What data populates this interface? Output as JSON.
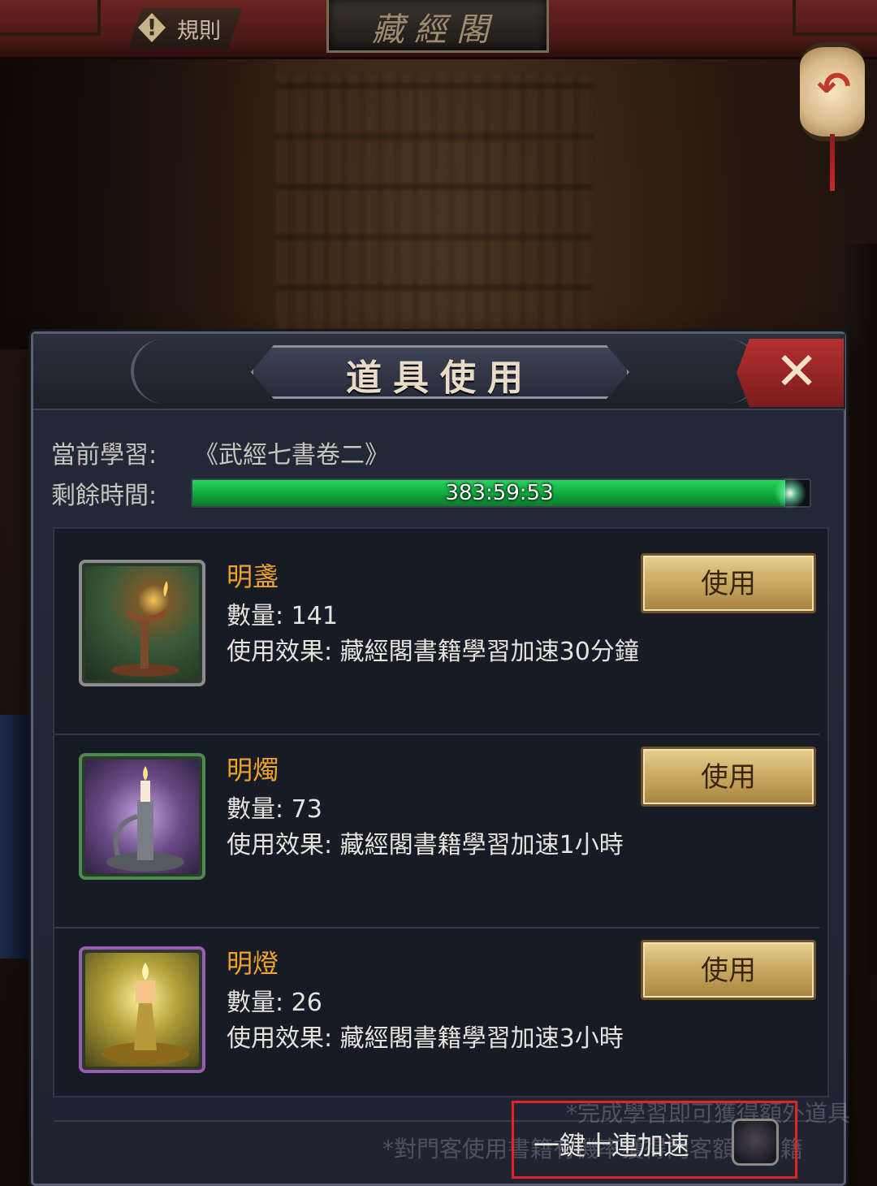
{
  "topbar": {
    "rules_label": "規則",
    "title": "藏經閣"
  },
  "dialog": {
    "title": "道具使用",
    "current_study_label": "當前學習:",
    "current_book": "《武經七書卷二》",
    "remaining_label": "剩餘時間:",
    "remaining_time": "383:59:53",
    "progress_fraction": 0.96
  },
  "items": [
    {
      "name": "明盞",
      "qty_text": "數量:  141",
      "effect_text": "使用效果:  藏經閣書籍學習加速30分鐘",
      "use_label": "使用",
      "icon": "oil-lamp-icon",
      "frame_color": "#8c8c8c",
      "bg_color": "#3a5a3a"
    },
    {
      "name": "明燭",
      "qty_text": "數量:  73",
      "effect_text": "使用效果:  藏經閣書籍學習加速1小時",
      "use_label": "使用",
      "icon": "candle-holder-icon",
      "frame_color": "#4d8a4d",
      "bg_color": "#6a4a86"
    },
    {
      "name": "明燈",
      "qty_text": "數量:  26",
      "effect_text": "使用效果:  藏經閣書籍學習加速3小時",
      "use_label": "使用",
      "icon": "candle-lamp-icon",
      "frame_color": "#9a5cb0",
      "bg_color": "#8a8a2a"
    }
  ],
  "footer": {
    "note_1": "*完成學習即可獲得額外道具",
    "note_2": "*對門客使用書籍有機率獲得門客額外書籍",
    "speedup_label": "一鍵十連加速",
    "speedup_checked": false
  },
  "colors": {
    "item_name": "#f0a22a",
    "progress": "#1bbf4a",
    "close_button": "#b53030",
    "highlight": "#e0242a"
  }
}
